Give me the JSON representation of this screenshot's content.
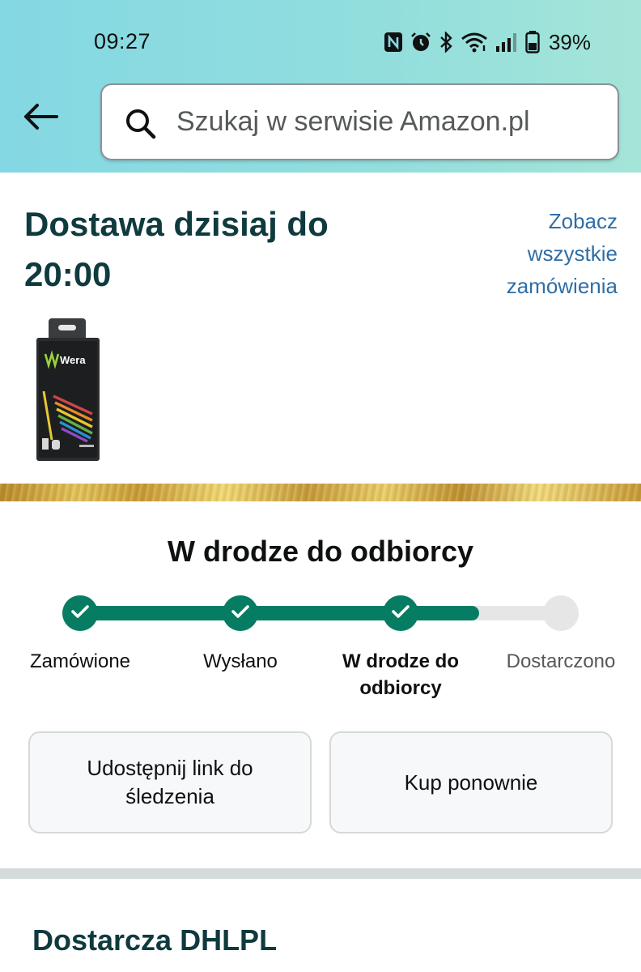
{
  "status_bar": {
    "time": "09:27",
    "icons": [
      "nfc-icon",
      "alarm-icon",
      "bluetooth-icon",
      "wifi-icon",
      "signal-icon",
      "battery-icon"
    ],
    "battery_percent": "39%"
  },
  "header": {
    "back_icon": "arrow-left-icon",
    "search_icon": "search-icon",
    "search_placeholder": "Szukaj w serwisie Amazon.pl"
  },
  "delivery": {
    "title": "Dostawa dzisiaj do 20:00",
    "orders_link": "Zobacz wszystkie zamówienia",
    "product_brand": "Wera"
  },
  "tracking": {
    "title": "W drodze do odbiorcy",
    "progress": 0.83,
    "steps": [
      {
        "label": "Zamówione",
        "state": "done"
      },
      {
        "label": "Wysłano",
        "state": "done"
      },
      {
        "label": "W drodze do odbiorcy",
        "state": "current"
      },
      {
        "label": "Dostarczono",
        "state": "pending"
      }
    ]
  },
  "actions": {
    "share_label": "Udostępnij link do śledzenia",
    "buy_again_label": "Kup ponownie"
  },
  "carrier": {
    "label": "Dostarcza DHLPL"
  },
  "colors": {
    "accent_green": "#067d62",
    "link_blue": "#2f6ea5",
    "heading": "#0f3a3e",
    "track_empty": "#e6e6e6"
  }
}
